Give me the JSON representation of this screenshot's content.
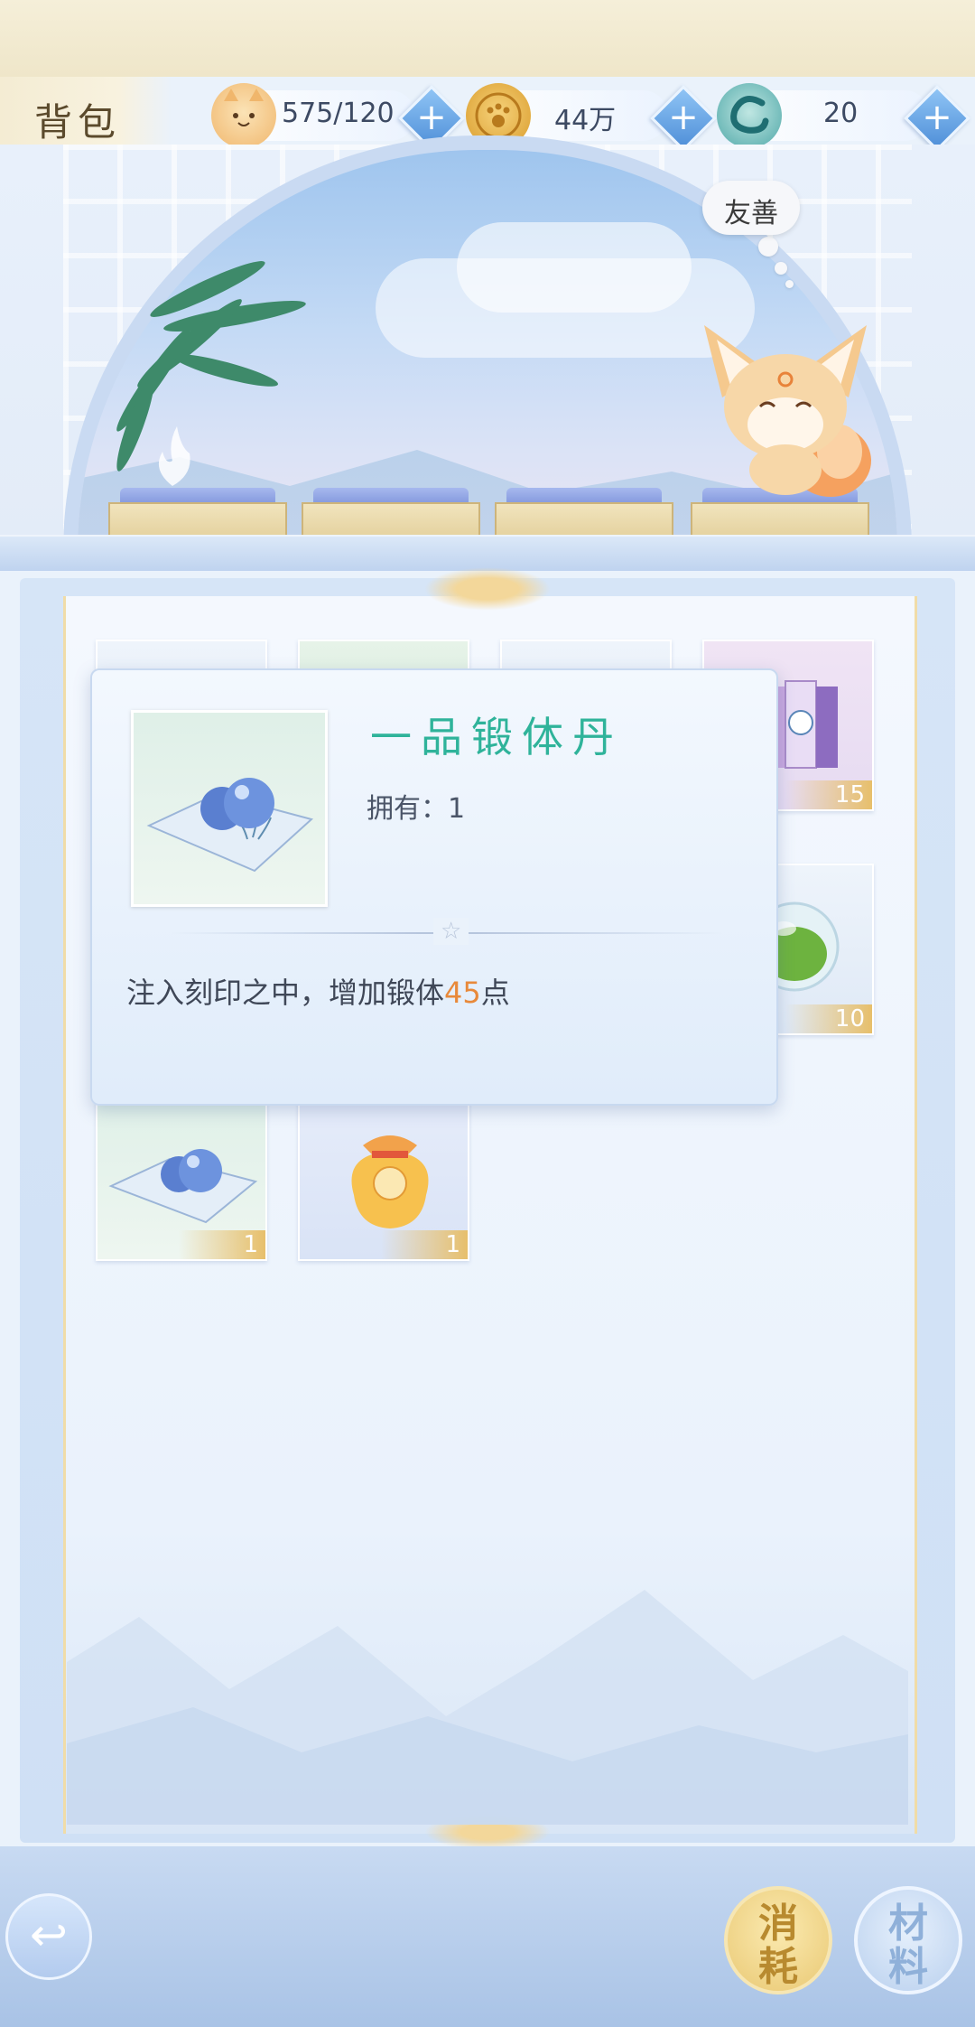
{
  "header": {
    "title": "背包",
    "resources": [
      {
        "icon": "cat-face-icon",
        "value": "575/120"
      },
      {
        "icon": "paw-coin-icon",
        "value": "44万"
      },
      {
        "icon": "jade-dragon-icon",
        "value": "20"
      }
    ],
    "plus_label": "+"
  },
  "scene": {
    "pet_mood": "友善",
    "pedestal_count": 4
  },
  "inventory": {
    "items": [
      {
        "name": "hidden-item-1",
        "qty": ""
      },
      {
        "name": "hidden-item-2",
        "qty": ""
      },
      {
        "name": "hidden-item-3",
        "qty": ""
      },
      {
        "name": "music-scroll-book",
        "qty": "15"
      },
      {
        "name": "green-orb",
        "qty": "10"
      },
      {
        "name": "blue-pills-on-cloth",
        "qty": "1"
      },
      {
        "name": "lucky-bag-xuan",
        "qty": "1"
      }
    ]
  },
  "tooltip": {
    "item_name": "一品锻体丹",
    "owned_label": "拥有：",
    "owned_value": "1",
    "divider_icon": "star-icon",
    "desc_prefix": "注入刻印之中，增加锻体",
    "desc_value": "45",
    "desc_suffix": "点",
    "accent_color": "#2fb39a",
    "value_color": "#e8893a"
  },
  "bottom_bar": {
    "back_icon": "back-arrow-icon",
    "tabs": [
      {
        "label": "消\n耗",
        "active": true
      },
      {
        "label": "材\n料",
        "active": false
      }
    ]
  }
}
